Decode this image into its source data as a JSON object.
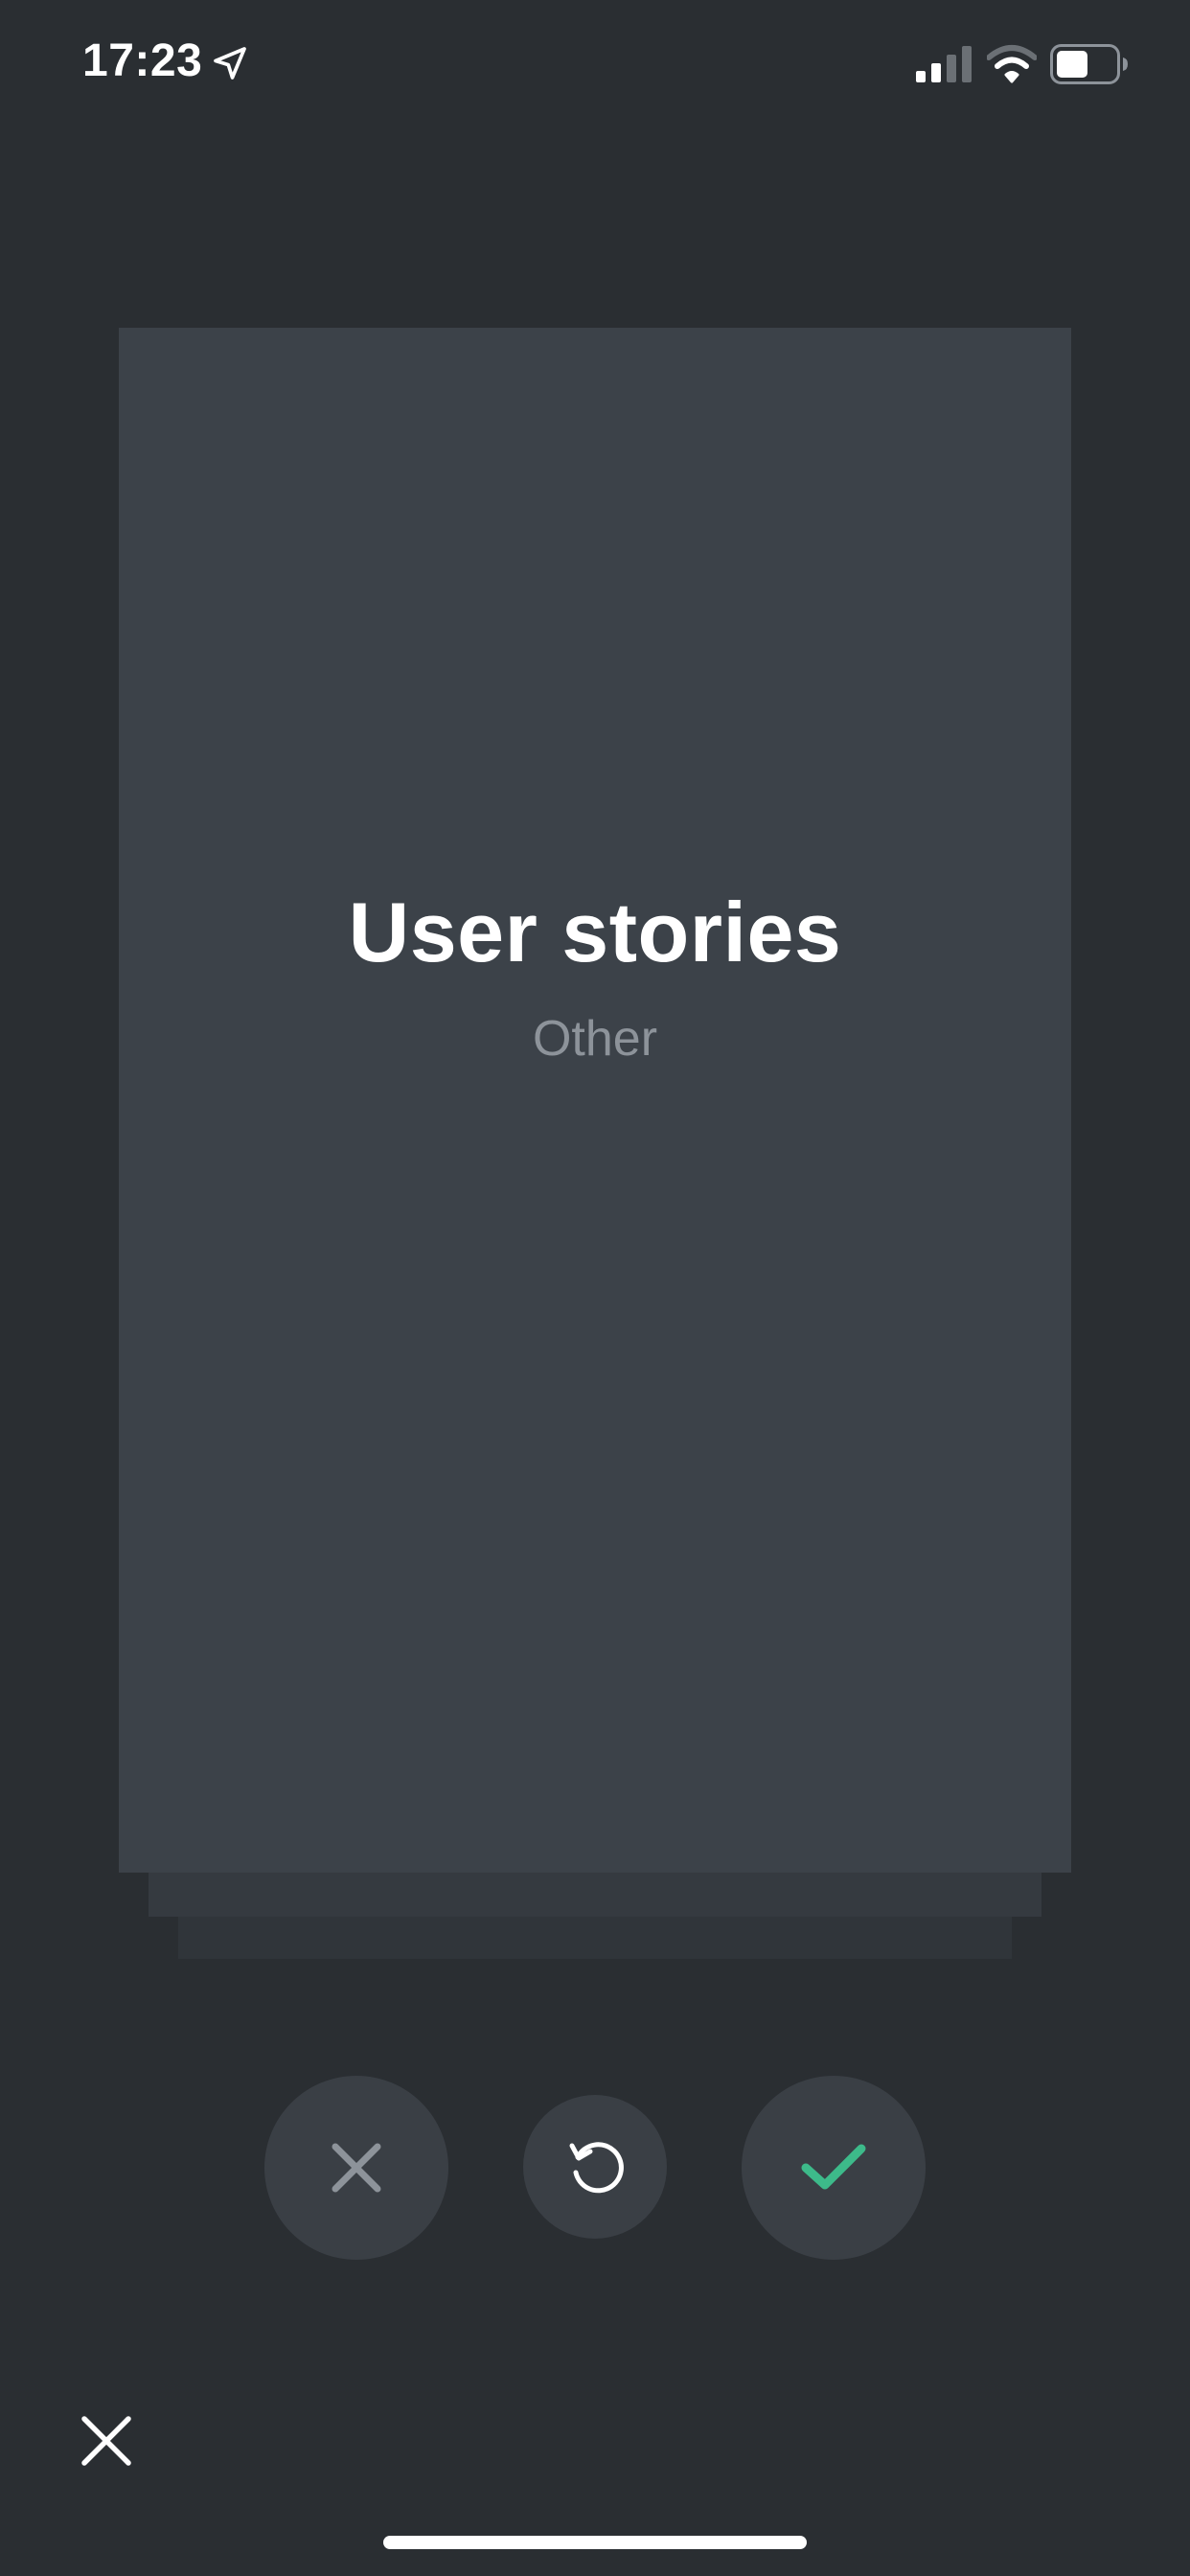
{
  "status_bar": {
    "time": "17:23",
    "icons": [
      "location-arrow-icon",
      "cellular-signal-icon",
      "wifi-icon",
      "battery-icon"
    ]
  },
  "card": {
    "title": "User stories",
    "subtitle": "Other"
  },
  "actions": {
    "reject_icon": "x-icon",
    "undo_icon": "undo-icon",
    "accept_icon": "check-icon",
    "accept_color": "#3dba8a"
  },
  "close_icon": "close-icon",
  "colors": {
    "background": "#2a2e32",
    "card": "#3c4249",
    "button": "#3a3f45",
    "muted_text": "#8d939a"
  }
}
